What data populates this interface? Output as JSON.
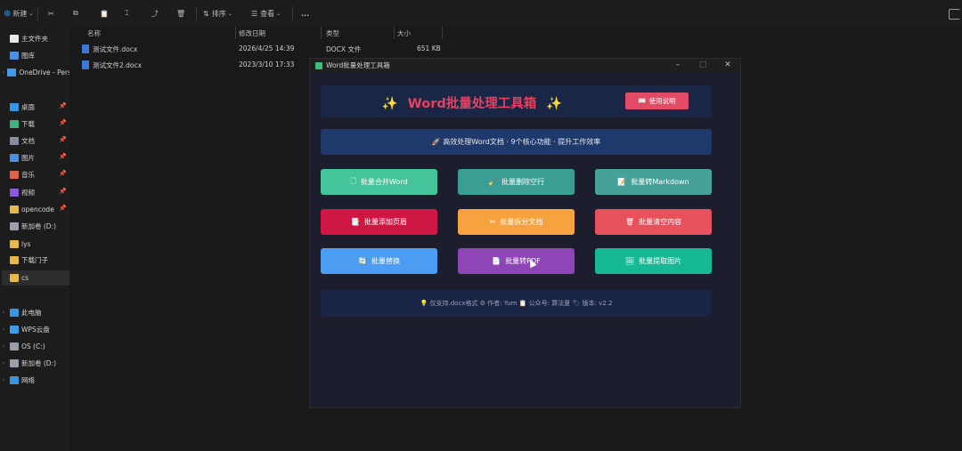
{
  "toolbar": {
    "new_label": "新建",
    "sort_label": "排序",
    "view_label": "查看",
    "more_label": "..."
  },
  "sidebar": {
    "items": [
      {
        "label": "主文件夹",
        "icon": "home-icon",
        "color": "#e8e8e8",
        "pinned": false,
        "expand": false
      },
      {
        "label": "图库",
        "icon": "gallery-icon",
        "color": "#4b8fe0",
        "pinned": false,
        "expand": false
      },
      {
        "label": "OneDrive - Person",
        "icon": "cloud-icon",
        "color": "#3d9bea",
        "pinned": false,
        "expand": true
      },
      {
        "label": "桌面",
        "icon": "desktop-icon",
        "color": "#3a95e0",
        "pinned": true,
        "expand": false
      },
      {
        "label": "下载",
        "icon": "download-icon",
        "color": "#3fb27f",
        "pinned": true,
        "expand": false
      },
      {
        "label": "文档",
        "icon": "document-icon",
        "color": "#8a8fa0",
        "pinned": true,
        "expand": false
      },
      {
        "label": "图片",
        "icon": "picture-icon",
        "color": "#4b8fe0",
        "pinned": true,
        "expand": false
      },
      {
        "label": "音乐",
        "icon": "music-icon",
        "color": "#e0624a",
        "pinned": true,
        "expand": false
      },
      {
        "label": "视频",
        "icon": "video-icon",
        "color": "#8a58d8",
        "pinned": true,
        "expand": false
      },
      {
        "label": "opencode",
        "icon": "folder-icon",
        "color": "#e6b94a",
        "pinned": true,
        "expand": false
      },
      {
        "label": "新加卷 (D:)",
        "icon": "drive-icon",
        "color": "#9aa0aa",
        "pinned": false,
        "expand": false
      },
      {
        "label": "lys",
        "icon": "folder-icon",
        "color": "#e6b94a",
        "pinned": false,
        "expand": false
      },
      {
        "label": "下载门子",
        "icon": "folder-icon",
        "color": "#e6b94a",
        "pinned": false,
        "expand": false
      },
      {
        "label": "cs",
        "icon": "folder-icon",
        "color": "#e6b94a",
        "pinned": false,
        "expand": false,
        "selected": true
      },
      {
        "label": "此电脑",
        "icon": "computer-icon",
        "color": "#3a95e0",
        "pinned": false,
        "expand": true
      },
      {
        "label": "WPS云盘",
        "icon": "wps-cloud-icon",
        "color": "#3d9bea",
        "pinned": false,
        "expand": true
      },
      {
        "label": "OS (C:)",
        "icon": "drive-icon",
        "color": "#9aa0aa",
        "pinned": false,
        "expand": true
      },
      {
        "label": "新加卷 (D:)",
        "icon": "drive-icon",
        "color": "#9aa0aa",
        "pinned": false,
        "expand": true
      },
      {
        "label": "网络",
        "icon": "network-icon",
        "color": "#3a95e0",
        "pinned": false,
        "expand": true
      }
    ]
  },
  "filelist": {
    "columns": [
      "名称",
      "修改日期",
      "类型",
      "大小"
    ],
    "rows": [
      {
        "name": "测试文件.docx",
        "date": "2026/4/25 14:39",
        "type": "DOCX 文件",
        "size": "651 KB"
      },
      {
        "name": "测试文件2.docx",
        "date": "2023/3/10 17:33",
        "type": "",
        "size": ""
      }
    ]
  },
  "app": {
    "window_title": "Word批量处理工具箱",
    "header_title": "Word批量处理工具箱",
    "header_spark": "✨",
    "header_button": "使用说明",
    "subtitle": "🚀 高效处理Word文档 · 9个核心功能 · 提升工作效率",
    "tiles": [
      {
        "label": "批量合并Word",
        "icon": "document-icon",
        "glyph": "🗋",
        "color": "#43c49a"
      },
      {
        "label": "批量删除空行",
        "icon": "broom-icon",
        "glyph": "🧹",
        "color": "#3a9e95"
      },
      {
        "label": "批量转Markdown",
        "icon": "convert-icon",
        "glyph": "📝",
        "color": "#46a198"
      },
      {
        "label": "批量添加页眉",
        "icon": "header-icon",
        "glyph": "📑",
        "color": "#cf1744"
      },
      {
        "label": "批量拆分文档",
        "icon": "scissors-icon",
        "glyph": "✂",
        "color": "#f6a33f"
      },
      {
        "label": "批量清空内容",
        "icon": "trash-icon",
        "glyph": "🗑",
        "color": "#e8505b"
      },
      {
        "label": "批量替换",
        "icon": "replace-icon",
        "glyph": "🔄",
        "color": "#4a9df2"
      },
      {
        "label": "批量转PDF",
        "icon": "pdf-icon",
        "glyph": "📄",
        "color": "#8e45b5"
      },
      {
        "label": "批量提取图片",
        "icon": "image-icon",
        "glyph": "🖼",
        "color": "#17b896"
      }
    ],
    "footer": "💡 仅支持.docx格式 ⚙ 作者: Yum 📋 公众号: 算法夏 🏷 版本: v2.2"
  }
}
